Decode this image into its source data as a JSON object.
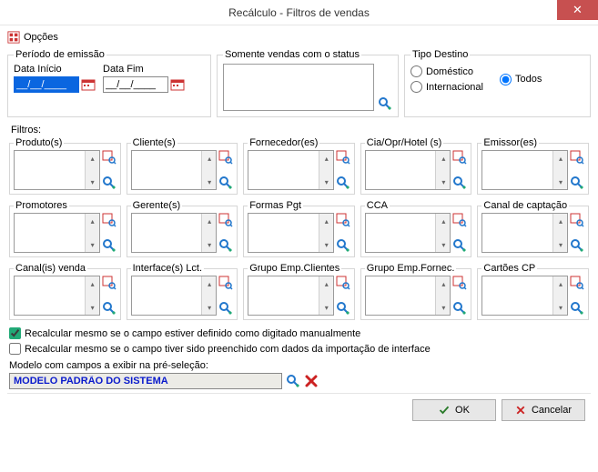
{
  "window": {
    "title": "Recálculo - Filtros de vendas"
  },
  "header": {
    "opcoes": "Opções"
  },
  "periodo": {
    "legend": "Período de emissão",
    "inicio_label": "Data Início",
    "fim_label": "Data Fim",
    "inicio_value": "__/__/____",
    "fim_value": "__/__/____"
  },
  "status": {
    "legend": "Somente vendas com o status"
  },
  "tipo": {
    "legend": "Tipo Destino",
    "domestico": "Doméstico",
    "internacional": "Internacional",
    "todos": "Todos",
    "selected": "todos"
  },
  "filtros_label": "Filtros:",
  "filters": [
    {
      "legend": "Produto(s)"
    },
    {
      "legend": "Cliente(s)"
    },
    {
      "legend": "Fornecedor(es)"
    },
    {
      "legend": "Cia/Opr/Hotel (s)"
    },
    {
      "legend": "Emissor(es)"
    },
    {
      "legend": "Promotores"
    },
    {
      "legend": "Gerente(s)"
    },
    {
      "legend": "Formas Pgt"
    },
    {
      "legend": "CCA"
    },
    {
      "legend": "Canal de captação"
    },
    {
      "legend": "Canal(is) venda"
    },
    {
      "legend": "Interface(s) Lct."
    },
    {
      "legend": "Grupo Emp.Clientes"
    },
    {
      "legend": "Grupo Emp.Fornec."
    },
    {
      "legend": "Cartões CP"
    }
  ],
  "checks": {
    "manual": "Recalcular mesmo se o campo estiver definido como digitado manualmente",
    "interface": "Recalcular mesmo se o campo tiver sido preenchido com dados da importação de interface",
    "manual_checked": true,
    "interface_checked": false
  },
  "model": {
    "label": "Modelo com campos a exibir na pré-seleção:",
    "value": "MODELO PADRÃO DO SISTEMA"
  },
  "buttons": {
    "ok": "OK",
    "cancel": "Cancelar"
  }
}
